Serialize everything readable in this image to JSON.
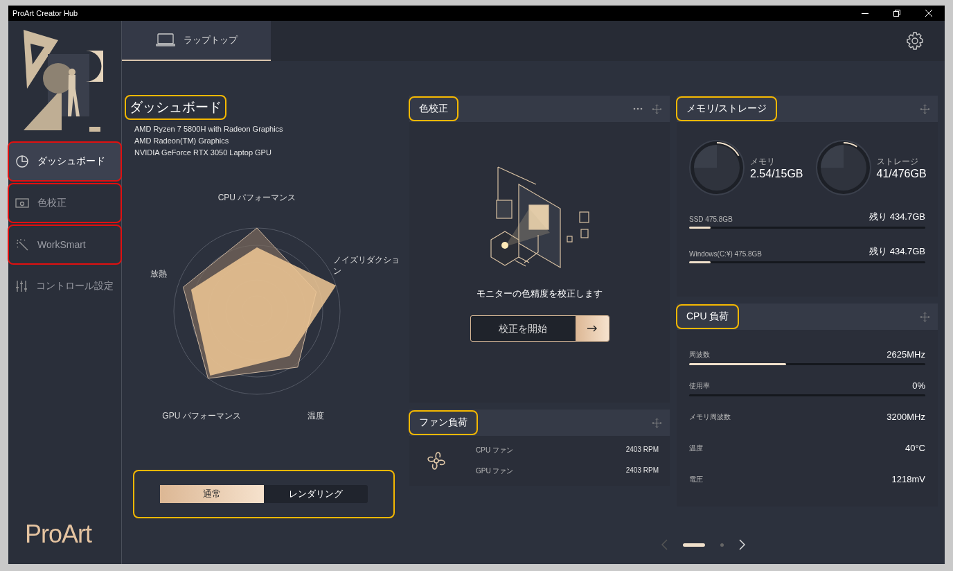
{
  "window": {
    "title": "ProArt Creator Hub"
  },
  "sidebar": {
    "logo": "ProArt",
    "items": [
      {
        "label": "ダッシュボード",
        "selected": true,
        "callout": true
      },
      {
        "label": "色校正",
        "selected": false,
        "callout": true
      },
      {
        "label": "WorkSmart",
        "selected": false,
        "callout": true
      },
      {
        "label": "コントロール設定",
        "selected": false,
        "callout": false
      }
    ]
  },
  "tabs": [
    {
      "label": "ラップトップ",
      "selected": true
    }
  ],
  "dashboard": {
    "title": "ダッシュボード",
    "callout": true,
    "specs": [
      "AMD Ryzen 7 5800H with Radeon Graphics",
      "AMD Radeon(TM) Graphics",
      "NVIDIA GeForce RTX 3050 Laptop GPU"
    ],
    "radar_labels": [
      "CPU パフォーマンス",
      "ノイズリダクショ",
      "ン",
      "温度",
      "GPU パフォーマンス",
      "放熱"
    ],
    "modes_callout": true,
    "modes": [
      {
        "label": "通常",
        "selected": true
      },
      {
        "label": "レンダリング",
        "selected": false
      }
    ]
  },
  "color_calibration": {
    "title": "色校正",
    "callout": true,
    "description": "モニターの色精度を校正します",
    "button": "校正を開始"
  },
  "fan_load": {
    "title": "ファン負荷",
    "callout": true,
    "fans": [
      {
        "name": "CPU ファン",
        "reading": "2403 RPM"
      },
      {
        "name": "GPU ファン",
        "reading": "2403 RPM"
      }
    ]
  },
  "memory_storage": {
    "title": "メモリ/ストレージ",
    "callout": true,
    "gauges": [
      {
        "label": "メモリ",
        "value": "2.54/15GB",
        "level": 0.17
      },
      {
        "label": "ストレージ",
        "value": "41/476GB",
        "level": 0.09
      }
    ],
    "drives": [
      {
        "name": "SSD 475.8GB",
        "remaining": "残り 434.7GB",
        "level": 0.09
      },
      {
        "name": "Windows(C:¥) 475.8GB",
        "remaining": "残り 434.7GB",
        "level": 0.09
      }
    ]
  },
  "cpu_load": {
    "title": "CPU 負荷",
    "callout": true,
    "metrics": [
      {
        "name": "周波数",
        "reading": "2625MHz",
        "kind": "bar",
        "level": 0.41
      },
      {
        "name": "使用率",
        "reading": "0%",
        "kind": "bar",
        "level": 0
      },
      {
        "name": "メモリ周波数",
        "reading": "3200MHz",
        "kind": "plain"
      },
      {
        "name": "温度",
        "reading": "40°C",
        "kind": "plain"
      },
      {
        "name": "電圧",
        "reading": "1218mV",
        "kind": "plain"
      }
    ]
  },
  "pagination": {
    "pages": [
      {
        "selected": true
      },
      {
        "selected": false
      }
    ]
  }
}
